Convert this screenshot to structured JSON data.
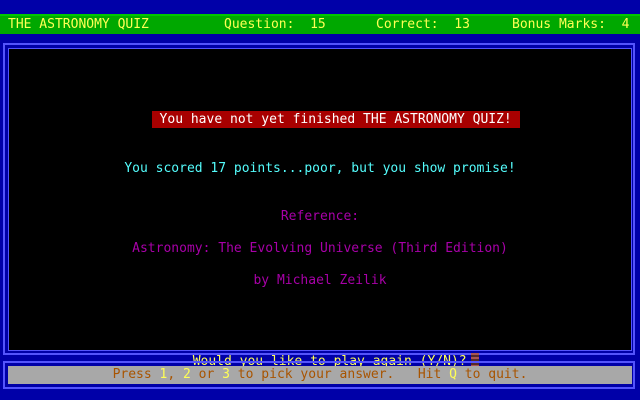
{
  "header": {
    "title": "THE ASTRONOMY QUIZ",
    "question_label": "Question:",
    "question_value": "15",
    "correct_label": "Correct:",
    "correct_value": "13",
    "bonus_label": "Bonus Marks:",
    "bonus_value": "4"
  },
  "main": {
    "banner": "You have not yet finished THE ASTRONOMY QUIZ!",
    "score_message": "You scored 17 points...poor, but you show promise!",
    "reference_label": "Reference:",
    "reference_title": "Astronomy: The Evolving Universe (Third Edition)",
    "reference_author": "by Michael Zeilik",
    "prompt": "Would you like to play again (Y/N)?"
  },
  "footer": {
    "press": "Press ",
    "key1": "1",
    "sep1": ", ",
    "key2": "2",
    "or": " or ",
    "key3": "3",
    "pick": " to pick your answer.   Hit ",
    "keyq": "Q",
    "quit": " to quit."
  },
  "colors": {
    "background": "#0000a8",
    "header_bar": "#00a800",
    "header_text": "#ffff54",
    "panel": "#000000",
    "banner_bg": "#a80000",
    "score_text": "#54fcfc",
    "reference_text": "#a800a8",
    "prompt_text": "#ffff54",
    "footer_bg": "#a8a8a8",
    "footer_text": "#a85400"
  }
}
